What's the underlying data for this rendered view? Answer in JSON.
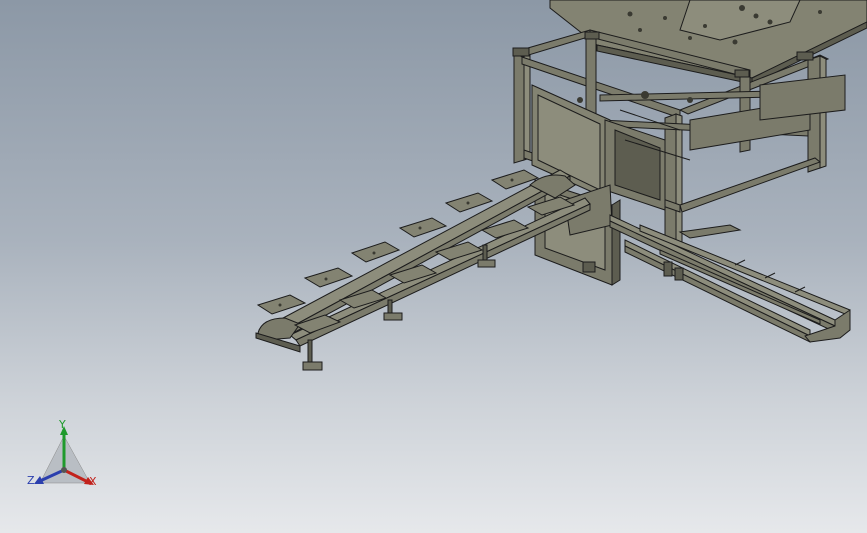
{
  "viewport": {
    "background_top": "#8c98a6",
    "background_bottom": "#e6e8eb",
    "model_color": "#7a7a6a",
    "edge_color": "#1e1e1e"
  },
  "triad": {
    "y_label": "Y",
    "z_label": "Z",
    "x_label": "X",
    "y_color": "#1f9a2c",
    "x_color": "#c2221c",
    "z_color": "#2b3fae"
  }
}
